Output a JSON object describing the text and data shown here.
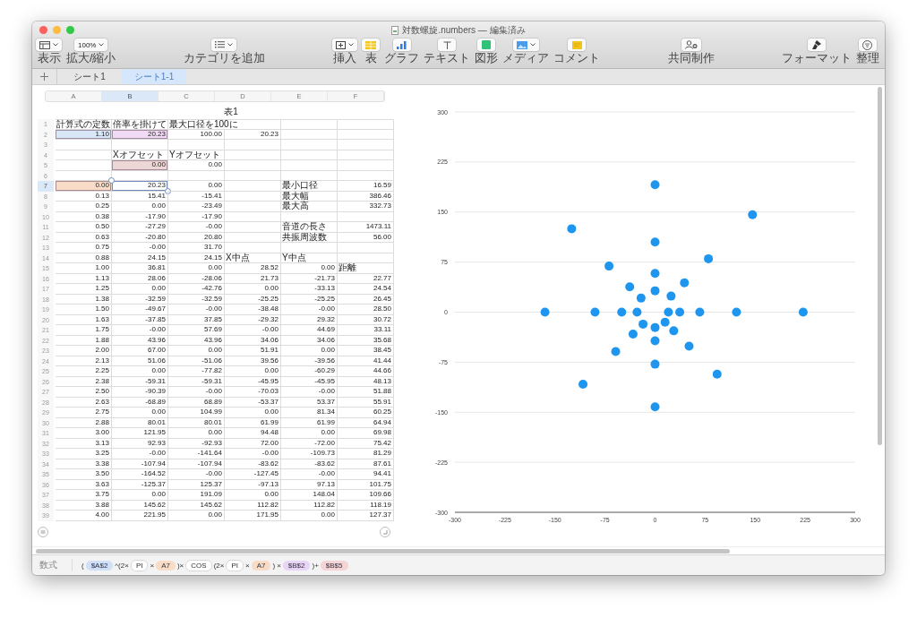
{
  "window": {
    "title": "対数螺旋.numbers — 編集済み"
  },
  "toolbar": [
    [
      {
        "kind": "view",
        "label": "表示"
      },
      {
        "kind": "zoom",
        "value": "100%",
        "label": "拡大/縮小"
      }
    ],
    [
      {
        "kind": "category",
        "label": "カテゴリを追加"
      }
    ],
    [
      {
        "kind": "insert",
        "label": "挿入"
      },
      {
        "kind": "table",
        "label": "表"
      },
      {
        "kind": "chart",
        "label": "グラフ"
      },
      {
        "kind": "text",
        "label": "テキスト"
      },
      {
        "kind": "shape",
        "label": "図形"
      },
      {
        "kind": "media",
        "label": "メディア"
      },
      {
        "kind": "comment",
        "label": "コメント"
      }
    ],
    [
      {
        "kind": "share",
        "label": "共同制作"
      }
    ],
    [
      {
        "kind": "format",
        "label": "フォーマット"
      },
      {
        "kind": "organize",
        "label": "整理"
      }
    ]
  ],
  "sheets": [
    {
      "label": "シート1",
      "selected": false
    },
    {
      "label": "シート1-1",
      "selected": true
    }
  ],
  "table": {
    "title": "表1",
    "columns": [
      {
        "label": "A",
        "selected": false
      },
      {
        "label": "B",
        "selected": true
      },
      {
        "label": "C",
        "selected": false
      },
      {
        "label": "D",
        "selected": false
      },
      {
        "label": "E",
        "selected": false
      },
      {
        "label": "F",
        "selected": false
      }
    ],
    "rows": [
      {
        "label": "1",
        "selected": false,
        "cells": {
          "a": {
            "kind": "label",
            "text": "計算式の定数"
          },
          "b": {
            "kind": "label",
            "text": "倍率を掛けて"
          },
          "c": {
            "kind": "label",
            "text": "最大口径を100に"
          }
        }
      },
      {
        "label": "2",
        "selected": false,
        "cells": {
          "a": {
            "text": "1.10",
            "color": "#d9e6f8"
          },
          "b": {
            "text": "20.23",
            "color": "#f1dbf4"
          },
          "c": "100.00",
          "d": "20.23"
        }
      },
      {
        "label": "3",
        "selected": false
      },
      {
        "label": "4",
        "selected": false,
        "cells": {
          "b": {
            "kind": "label",
            "text": "Xオフセット"
          },
          "c": {
            "kind": "label",
            "text": "Yオフセット"
          }
        }
      },
      {
        "label": "5",
        "selected": false,
        "cells": {
          "b": {
            "text": "0.00",
            "color": "#ecd6d6"
          },
          "c": "0.00"
        }
      },
      {
        "label": "6",
        "selected": false
      },
      {
        "label": "7",
        "selected": true,
        "cells": {
          "a": {
            "text": "0.00",
            "color": "#f8dcc8"
          },
          "b": {
            "text": "20.23",
            "selected": true
          },
          "c": "0.00",
          "e": {
            "kind": "label",
            "text": "最小口径"
          },
          "f": "16.59"
        }
      },
      {
        "label": "8",
        "selected": false,
        "cells": {
          "a": "0.13",
          "b": "15.41",
          "c": "-15.41",
          "e": {
            "kind": "label",
            "text": "最大幅"
          },
          "f": "386.46"
        }
      },
      {
        "label": "9",
        "selected": false,
        "cells": {
          "a": "0.25",
          "b": "0.00",
          "c": "-23.49",
          "e": {
            "kind": "label",
            "text": "最大高"
          },
          "f": "332.73"
        }
      },
      {
        "label": "10",
        "selected": false,
        "cells": {
          "a": "0.38",
          "b": "-17.90",
          "c": "-17.90"
        }
      },
      {
        "label": "11",
        "selected": false,
        "cells": {
          "a": "0.50",
          "b": "-27.29",
          "c": "-0.00",
          "e": {
            "kind": "label",
            "text": "音道の長さ"
          },
          "f": "1473.11"
        }
      },
      {
        "label": "12",
        "selected": false,
        "cells": {
          "a": "0.63",
          "b": "-20.80",
          "c": "20.80",
          "e": {
            "kind": "label",
            "text": "共振周波数"
          },
          "f": "56.00"
        }
      },
      {
        "label": "13",
        "selected": false,
        "cells": {
          "a": "0.75",
          "b": "-0.00",
          "c": "31.70"
        }
      },
      {
        "label": "14",
        "selected": false,
        "cells": {
          "a": "0.88",
          "b": "24.15",
          "c": "24.15",
          "d": {
            "kind": "label",
            "text": "X中点"
          },
          "e": {
            "kind": "label",
            "text": "Y中点"
          }
        }
      },
      {
        "label": "15",
        "selected": false,
        "cells": {
          "a": "1.00",
          "b": "36.81",
          "c": "0.00",
          "d": "28.52",
          "e": "0.00",
          "f": {
            "kind": "label",
            "text": "距離"
          }
        }
      },
      {
        "label": "16",
        "selected": false,
        "cells": {
          "a": "1.13",
          "b": "28.06",
          "c": "-28.06",
          "d": "21.73",
          "e": "-21.73",
          "f": "22.77"
        }
      },
      {
        "label": "17",
        "selected": false,
        "cells": {
          "a": "1.25",
          "b": "0.00",
          "c": "-42.76",
          "d": "0.00",
          "e": "-33.13",
          "f": "24.54"
        }
      },
      {
        "label": "18",
        "selected": false,
        "cells": {
          "a": "1.38",
          "b": "-32.59",
          "c": "-32.59",
          "d": "-25.25",
          "e": "-25.25",
          "f": "26.45"
        }
      },
      {
        "label": "19",
        "selected": false,
        "cells": {
          "a": "1.50",
          "b": "-49.67",
          "c": "-0.00",
          "d": "-38.48",
          "e": "-0.00",
          "f": "28.50"
        }
      },
      {
        "label": "20",
        "selected": false,
        "cells": {
          "a": "1.63",
          "b": "-37.85",
          "c": "37.85",
          "d": "-29.32",
          "e": "29.32",
          "f": "30.72"
        }
      },
      {
        "label": "21",
        "selected": false,
        "cells": {
          "a": "1.75",
          "b": "-0.00",
          "c": "57.69",
          "d": "-0.00",
          "e": "44.69",
          "f": "33.11"
        }
      },
      {
        "label": "22",
        "selected": false,
        "cells": {
          "a": "1.88",
          "b": "43.96",
          "c": "43.96",
          "d": "34.06",
          "e": "34.06",
          "f": "35.68"
        }
      },
      {
        "label": "23",
        "selected": false,
        "cells": {
          "a": "2.00",
          "b": "67.00",
          "c": "0.00",
          "d": "51.91",
          "e": "0.00",
          "f": "38.45"
        }
      },
      {
        "label": "24",
        "selected": false,
        "cells": {
          "a": "2.13",
          "b": "51.06",
          "c": "-51.06",
          "d": "39.56",
          "e": "-39.56",
          "f": "41.44"
        }
      },
      {
        "label": "25",
        "selected": false,
        "cells": {
          "a": "2.25",
          "b": "0.00",
          "c": "-77.82",
          "d": "0.00",
          "e": "-60.29",
          "f": "44.66"
        }
      },
      {
        "label": "26",
        "selected": false,
        "cells": {
          "a": "2.38",
          "b": "-59.31",
          "c": "-59.31",
          "d": "-45.95",
          "e": "-45.95",
          "f": "48.13"
        }
      },
      {
        "label": "27",
        "selected": false,
        "cells": {
          "a": "2.50",
          "b": "-90.39",
          "c": "-0.00",
          "d": "-70.03",
          "e": "-0.00",
          "f": "51.88"
        }
      },
      {
        "label": "28",
        "selected": false,
        "cells": {
          "a": "2.63",
          "b": "-68.89",
          "c": "68.89",
          "d": "-53.37",
          "e": "53.37",
          "f": "55.91"
        }
      },
      {
        "label": "29",
        "selected": false,
        "cells": {
          "a": "2.75",
          "b": "0.00",
          "c": "104.99",
          "d": "0.00",
          "e": "81.34",
          "f": "60.25"
        }
      },
      {
        "label": "30",
        "selected": false,
        "cells": {
          "a": "2.88",
          "b": "80.01",
          "c": "80.01",
          "d": "61.99",
          "e": "61.99",
          "f": "64.94"
        }
      },
      {
        "label": "31",
        "selected": false,
        "cells": {
          "a": "3.00",
          "b": "121.95",
          "c": "0.00",
          "d": "94.48",
          "e": "0.00",
          "f": "69.98"
        }
      },
      {
        "label": "32",
        "selected": false,
        "cells": {
          "a": "3.13",
          "b": "92.93",
          "c": "-92.93",
          "d": "72.00",
          "e": "-72.00",
          "f": "75.42"
        }
      },
      {
        "label": "33",
        "selected": false,
        "cells": {
          "a": "3.25",
          "b": "-0.00",
          "c": "-141.64",
          "d": "-0.00",
          "e": "-109.73",
          "f": "81.29"
        }
      },
      {
        "label": "34",
        "selected": false,
        "cells": {
          "a": "3.38",
          "b": "-107.94",
          "c": "-107.94",
          "d": "-83.62",
          "e": "-83.62",
          "f": "87.61"
        }
      },
      {
        "label": "35",
        "selected": false,
        "cells": {
          "a": "3.50",
          "b": "-164.52",
          "c": "-0.00",
          "d": "-127.45",
          "e": "-0.00",
          "f": "94.41"
        }
      },
      {
        "label": "36",
        "selected": false,
        "cells": {
          "a": "3.63",
          "b": "-125.37",
          "c": "125.37",
          "d": "-97.13",
          "e": "97.13",
          "f": "101.75"
        }
      },
      {
        "label": "37",
        "selected": false,
        "cells": {
          "a": "3.75",
          "b": "0.00",
          "c": "191.09",
          "d": "0.00",
          "e": "148.04",
          "f": "109.66"
        }
      },
      {
        "label": "38",
        "selected": false,
        "cells": {
          "a": "3.88",
          "b": "145.62",
          "c": "145.62",
          "d": "112.82",
          "e": "112.82",
          "f": "118.19"
        }
      },
      {
        "label": "39",
        "selected": false,
        "cells": {
          "a": "4.00",
          "b": "221.95",
          "c": "0.00",
          "d": "171.95",
          "e": "0.00",
          "f": "127.37"
        }
      }
    ]
  },
  "chart": {
    "chart_data": {
      "type": "scatter",
      "grid": true,
      "x": [
        20,
        15,
        0,
        -18,
        -27,
        -21,
        0,
        24,
        37,
        28,
        0,
        -33,
        -50,
        -38,
        0,
        44,
        67,
        51,
        0,
        -59,
        -90,
        -69,
        0,
        80,
        122,
        93,
        0,
        -108,
        -165,
        -125,
        0,
        146,
        222
      ],
      "series": [
        {
          "color": "#1e96f0",
          "values": [
            0,
            -15,
            -23,
            -18,
            0,
            21,
            32,
            24,
            0,
            -28,
            -43,
            -33,
            0,
            38,
            58,
            44,
            0,
            -51,
            -78,
            -59,
            0,
            69,
            105,
            80,
            0,
            -93,
            -142,
            -108,
            0,
            125,
            191,
            146,
            0
          ]
        }
      ],
      "xlim": [
        -300,
        300
      ],
      "ylim": [
        -300,
        300
      ],
      "xticks": [
        -300,
        -225,
        -150,
        -75,
        0,
        75,
        150,
        225,
        300
      ],
      "yticks": [
        -300,
        -225,
        -150,
        -75,
        0,
        75,
        150,
        225,
        300
      ]
    }
  },
  "formula": {
    "label": "数式",
    "tokens": [
      {
        "kind": "op",
        "text": "("
      },
      {
        "kind": "ref",
        "text": "$A$2",
        "color": "#cfe0f8"
      },
      {
        "kind": "op",
        "text": "^(2×"
      },
      {
        "kind": "func",
        "text": "PI"
      },
      {
        "kind": "op",
        "text": "×"
      },
      {
        "kind": "ref",
        "text": "A7",
        "color": "#f8dcc6"
      },
      {
        "kind": "op",
        "text": ")×"
      },
      {
        "kind": "func",
        "text": "COS"
      },
      {
        "kind": "op",
        "text": "(2×"
      },
      {
        "kind": "func",
        "text": "PI"
      },
      {
        "kind": "op",
        "text": "×"
      },
      {
        "kind": "ref",
        "text": "A7",
        "color": "#f8dcc6"
      },
      {
        "kind": "op",
        "text": ")"
      },
      {
        "kind": "op",
        "text": "×"
      },
      {
        "kind": "ref",
        "text": "$B$2",
        "color": "#e8d4f4"
      },
      {
        "kind": "op",
        "text": ")+"
      },
      {
        "kind": "ref",
        "text": "$B$5",
        "color": "#f4d4d4"
      }
    ]
  }
}
